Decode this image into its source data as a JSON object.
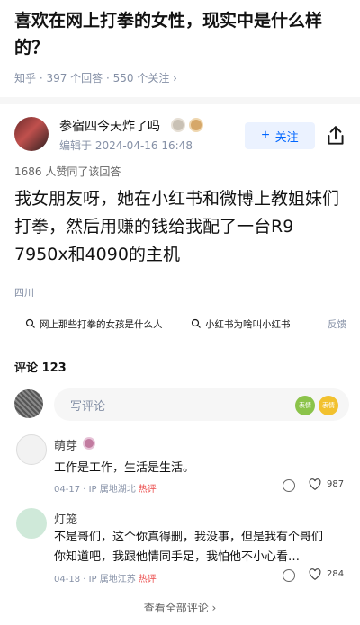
{
  "question": {
    "title": "喜欢在网上打拳的女性，现实中是什么样的？",
    "meta": "知乎 · 397 个回答 · 550 个关注 ›"
  },
  "author": {
    "name": "参宿四今天炸了吗",
    "edit_time": "编辑于 2024-04-16 16:48",
    "follow_label": "关注",
    "follow_icon": "plus-icon"
  },
  "answer": {
    "endorse": "1686 人赞同了该回答",
    "body": "我女朋友呀，她在小红书和微博上教姐妹们打拳，然后用赚的钱给我配了一台R9 7950x和4090的主机",
    "location": "四川"
  },
  "related": {
    "chips": [
      "网上那些打拳的女孩是什么人",
      "小红书为啥叫小红书"
    ],
    "feedback": "反馈"
  },
  "comments": {
    "title": "评论 123",
    "placeholder": "写评论",
    "emoji_label": "表情",
    "items": [
      {
        "name": "萌芽",
        "text": "工作是工作，生活是生活。",
        "date": "04-17 · IP 属地湖北",
        "hot": "热评",
        "likes": "987"
      },
      {
        "name": "灯笼",
        "text": "不是哥们，这个你真得删，我没事，但是我有个哥们你知道吧，我跟他情同手足，我怕他不小心看…",
        "date": "04-18 · IP 属地江苏",
        "hot": "热评",
        "likes": "284"
      }
    ],
    "view_all": "查看全部评论 ›"
  },
  "colors": {
    "accent": "#0066ff",
    "hot": "#eb4a4a",
    "muted": "#8590a6"
  }
}
